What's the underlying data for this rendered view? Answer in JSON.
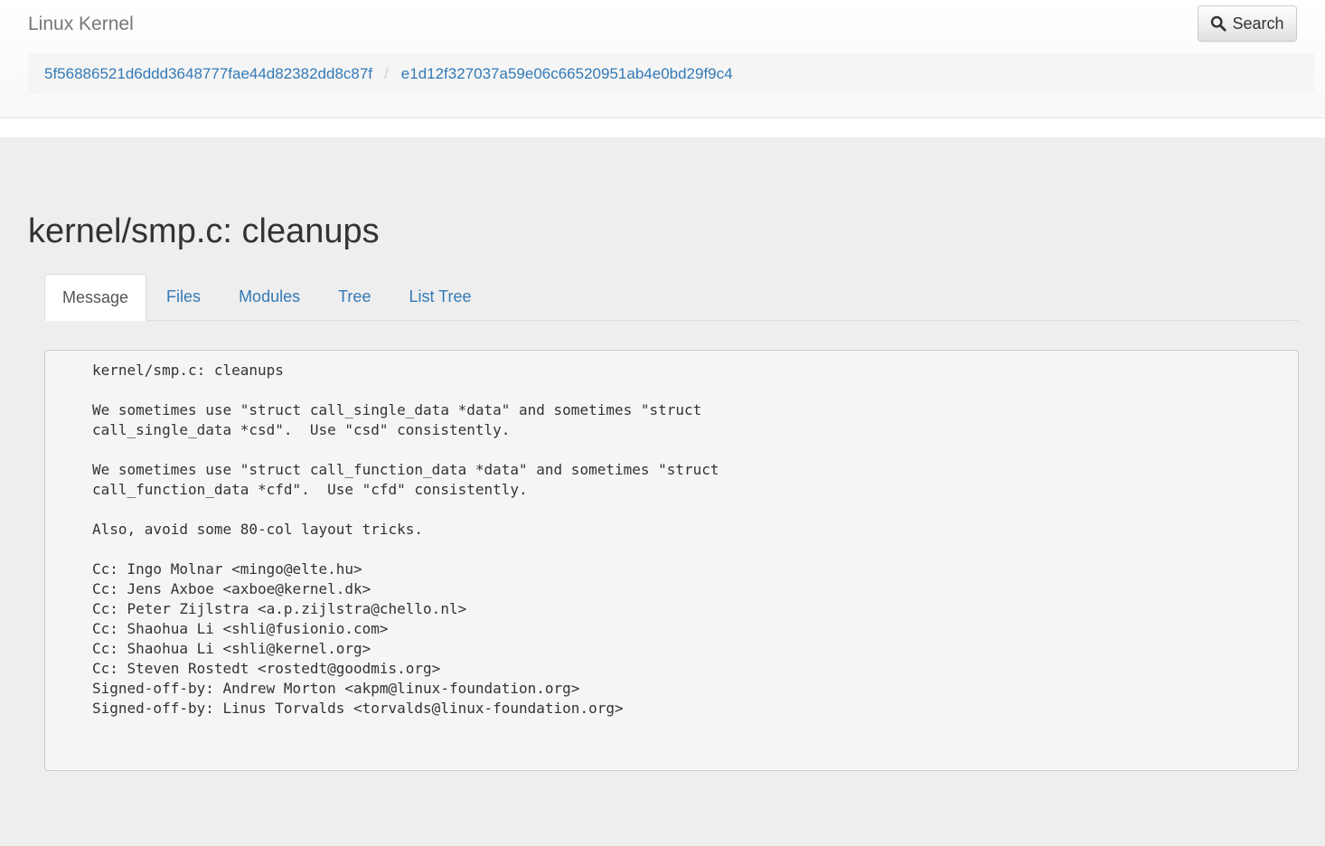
{
  "navbar": {
    "brand": "Linux Kernel",
    "search_label": "Search"
  },
  "breadcrumb": [
    "5f56886521d6ddd3648777fae44d82382dd8c87f",
    "e1d12f327037a59e06c66520951ab4e0bd29f9c4"
  ],
  "breadcrumb_separator": "/",
  "page": {
    "title": "kernel/smp.c: cleanups"
  },
  "tabs": [
    {
      "label": "Message",
      "active": true
    },
    {
      "label": "Files",
      "active": false
    },
    {
      "label": "Modules",
      "active": false
    },
    {
      "label": "Tree",
      "active": false
    },
    {
      "label": "List Tree",
      "active": false
    }
  ],
  "message": "kernel/smp.c: cleanups\n\nWe sometimes use \"struct call_single_data *data\" and sometimes \"struct\ncall_single_data *csd\".  Use \"csd\" consistently.\n\nWe sometimes use \"struct call_function_data *data\" and sometimes \"struct\ncall_function_data *cfd\".  Use \"cfd\" consistently.\n\nAlso, avoid some 80-col layout tricks.\n\nCc: Ingo Molnar <mingo@elte.hu>\nCc: Jens Axboe <axboe@kernel.dk>\nCc: Peter Zijlstra <a.p.zijlstra@chello.nl>\nCc: Shaohua Li <shli@fusionio.com>\nCc: Shaohua Li <shli@kernel.org>\nCc: Steven Rostedt <rostedt@goodmis.org>\nSigned-off-by: Andrew Morton <akpm@linux-foundation.org>\nSigned-off-by: Linus Torvalds <torvalds@linux-foundation.org>",
  "colors": {
    "link": "#337ab7",
    "background": "#eeeeee",
    "panel": "#f5f5f5"
  },
  "icons": {
    "search": "search-icon"
  }
}
